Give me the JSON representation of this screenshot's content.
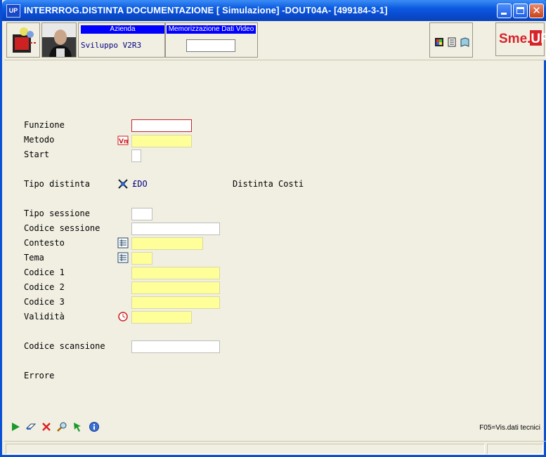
{
  "window": {
    "app_icon_text": "UP",
    "title": "INTERRROG.DISTINTA DOCUMENTAZIONE [ Simulazione] -DOUT04A- [499184-3-1]"
  },
  "header": {
    "azienda_label": "Azienda",
    "azienda_value": "Sviluppo V2R3",
    "memorizzazione_label": "Memorizzazione Dati Video",
    "memorizzazione_value": "",
    "logo_text_1": "Sme.",
    "logo_text_2": "UP"
  },
  "form": {
    "funzione_label": "Funzione",
    "funzione_value": "",
    "metodo_label": "Metodo",
    "metodo_value": "",
    "start_label": "Start",
    "start_value": "",
    "tipo_distinta_label": "Tipo distinta",
    "tipo_distinta_code": "£DO",
    "tipo_distinta_desc": "Distinta Costi",
    "tipo_sessione_label": "Tipo sessione",
    "tipo_sessione_value": "",
    "codice_sessione_label": "Codice sessione",
    "codice_sessione_value": "",
    "contesto_label": "Contesto",
    "contesto_value": "",
    "tema_label": "Tema",
    "tema_value": "",
    "codice1_label": "Codice 1",
    "codice1_value": "",
    "codice2_label": "Codice 2",
    "codice2_value": "",
    "codice3_label": "Codice 3",
    "codice3_value": "",
    "validita_label": "Validità",
    "validita_value": "",
    "codice_scansione_label": "Codice scansione",
    "codice_scansione_value": "",
    "errore_label": "Errore"
  },
  "bottom": {
    "fkey_hint": "F05=Vis.dati tecnici"
  },
  "colors": {
    "titlebar": "#0a4fd6",
    "background": "#f1efe2",
    "required_field": "#ffff99",
    "header_label_bg": "#0000ff",
    "logo_red": "#d7232a",
    "focus_border": "#c4232c"
  },
  "icons": [
    "app-icon",
    "minimize-icon",
    "maximize-icon",
    "close-icon",
    "printer-icon",
    "user-photo-icon",
    "color-palette-icon",
    "notes-icon",
    "book-icon",
    "vm-method-icon",
    "object-link-icon",
    "list-icon",
    "clock-icon",
    "run-icon",
    "eraser-icon",
    "cancel-icon",
    "search-icon",
    "refresh-icon",
    "info-icon"
  ]
}
